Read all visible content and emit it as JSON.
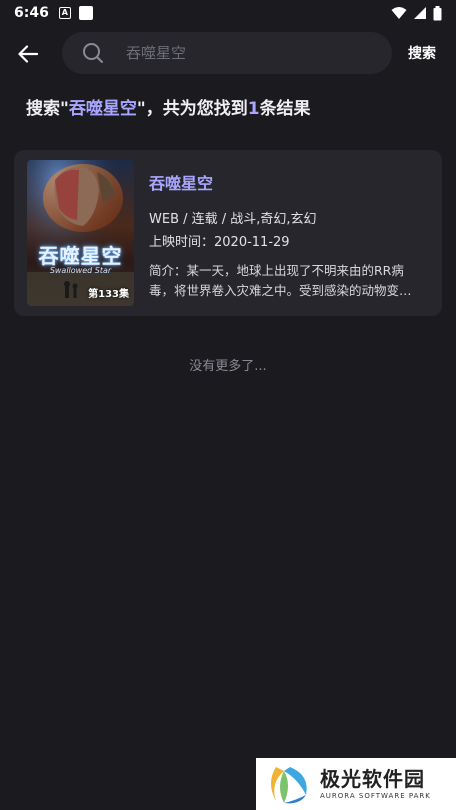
{
  "status_bar": {
    "time": "6:46",
    "notification_icon": "A",
    "icons": [
      "wifi-icon",
      "signal-icon",
      "battery-icon"
    ]
  },
  "header": {
    "back_icon": "arrow-left-icon",
    "search_placeholder": "吞噬星空",
    "search_icon": "search-icon",
    "search_button": "搜索"
  },
  "summary": {
    "prefix": "搜索\"",
    "keyword": "吞噬星空",
    "middle": "\"，共为您找到",
    "count": "1",
    "suffix": "条结果"
  },
  "results": [
    {
      "title": "吞噬星空",
      "meta": "WEB / 连载 / 战斗,奇幻,玄幻",
      "date_label": "上映时间：2020-11-29",
      "description": "简介：某一天，地球上出现了不明来由的RR病毒，将世界卷入灾难之中。受到感染的动物变异，危害人类…",
      "poster": {
        "title": "吞噬星空",
        "subtitle": "Swallowed Star",
        "episode": "第133集"
      }
    }
  ],
  "footer_text": "没有更多了...",
  "watermark": {
    "cn": "极光软件园",
    "en": "AURORA SOFTWARE PARK"
  },
  "colors": {
    "background": "#1a1a1f",
    "card": "#26262c",
    "accent": "#a9a6ff"
  }
}
